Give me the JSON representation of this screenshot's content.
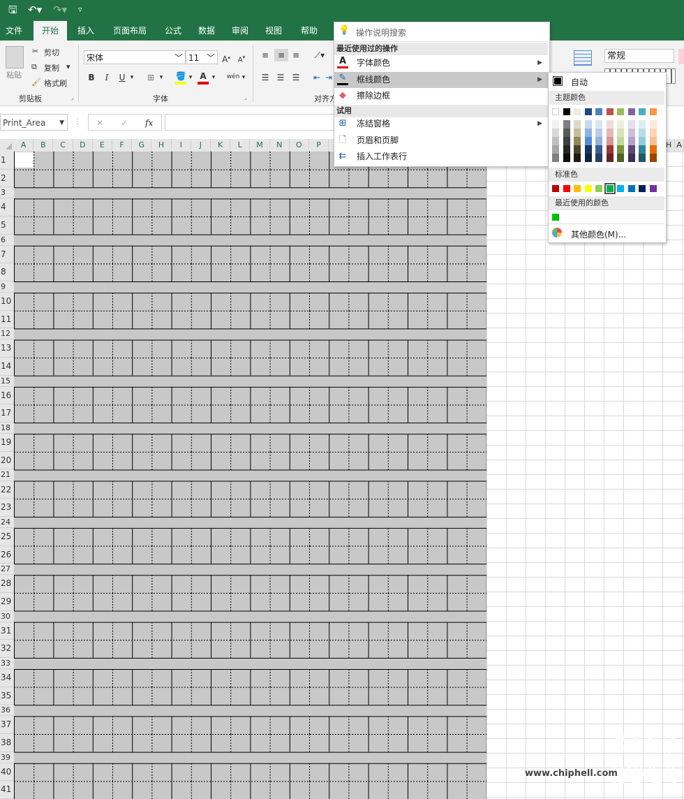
{
  "ribbon_tabs": [
    "文件",
    "开始",
    "插入",
    "页面布局",
    "公式",
    "数据",
    "审阅",
    "视图",
    "帮助"
  ],
  "active_tab": "开始",
  "clipboard": {
    "paste": "粘贴",
    "cut": "剪切",
    "copy": "复制",
    "format_painter": "格式刷",
    "group": "剪贴板"
  },
  "font": {
    "name": "宋体",
    "size": "11",
    "bold": "B",
    "italic": "I",
    "underline": "U",
    "group": "字体",
    "phonetic": "wén"
  },
  "alignment": {
    "group_partial": "对齐方"
  },
  "number_format": {
    "value": "常规"
  },
  "formula_bar": {
    "name_box": "Print_Area",
    "fx": "fx",
    "cancel": "✕",
    "enter": "✓"
  },
  "columns": [
    "A",
    "B",
    "C",
    "D",
    "E",
    "F",
    "G",
    "H",
    "I",
    "J",
    "K",
    "L",
    "M",
    "N",
    "O",
    "P"
  ],
  "columns_right": [
    "H",
    "A"
  ],
  "rows": [
    "1",
    "2",
    "3",
    "4",
    "5",
    "6",
    "7",
    "8",
    "9",
    "10",
    "11",
    "12",
    "13",
    "14",
    "15",
    "16",
    "17",
    "18",
    "19",
    "20",
    "21",
    "22",
    "23",
    "24",
    "25",
    "26",
    "27",
    "28",
    "29",
    "30",
    "31",
    "32",
    "33",
    "34",
    "35",
    "36",
    "37",
    "38",
    "39",
    "40",
    "41"
  ],
  "search_menu": {
    "placeholder": "操作说明搜索",
    "recent_header": "最近使用过的操作",
    "recent_items": [
      {
        "label": "字体颜色",
        "icon": "font-color-icon",
        "has_submenu": true
      },
      {
        "label": "框线颜色",
        "icon": "border-color-icon",
        "has_submenu": true
      },
      {
        "label": "擦除边框",
        "icon": "eraser-icon",
        "has_submenu": false
      }
    ],
    "try_header": "试用",
    "try_items": [
      {
        "label": "冻结窗格",
        "icon": "freeze-panes-icon",
        "has_submenu": true
      },
      {
        "label": "页眉和页脚",
        "icon": "header-footer-icon",
        "has_submenu": false
      },
      {
        "label": "插入工作表行",
        "icon": "insert-rows-icon",
        "has_submenu": false
      }
    ]
  },
  "color_menu": {
    "auto_label": "自动",
    "theme_header": "主题颜色",
    "theme_top": [
      "#ffffff",
      "#000000",
      "#eeece1",
      "#1f497d",
      "#4f81bd",
      "#c0504d",
      "#9bbb59",
      "#8064a2",
      "#4bacc6",
      "#f79646"
    ],
    "theme_shades": [
      [
        "#f2f2f2",
        "#d9d9d9",
        "#bfbfbf",
        "#a6a6a6",
        "#808080"
      ],
      [
        "#7f7f7f",
        "#595959",
        "#3f3f3f",
        "#262626",
        "#0d0d0d"
      ],
      [
        "#ddd9c3",
        "#c4bd97",
        "#948a54",
        "#4a452a",
        "#1e1c11"
      ],
      [
        "#c6d9f0",
        "#8db3e2",
        "#548dd4",
        "#17365d",
        "#0f243e"
      ],
      [
        "#dbe5f1",
        "#b8cce4",
        "#95b3d7",
        "#366092",
        "#244061"
      ],
      [
        "#f2dcdb",
        "#e5b9b7",
        "#d99694",
        "#953734",
        "#632423"
      ],
      [
        "#ebf1dd",
        "#d7e3bc",
        "#c3d69b",
        "#76923c",
        "#4f6128"
      ],
      [
        "#e5e0ec",
        "#ccc1d9",
        "#b2a2c7",
        "#5f497a",
        "#3f3151"
      ],
      [
        "#dbeef3",
        "#b7dde8",
        "#92cddc",
        "#31859b",
        "#205867"
      ],
      [
        "#fdeada",
        "#fbd5b5",
        "#fac08f",
        "#e36c09",
        "#974806"
      ]
    ],
    "standard_header": "标准色",
    "standard": [
      "#c00000",
      "#ff0000",
      "#ffc000",
      "#ffff00",
      "#92d050",
      "#00b050",
      "#00b0f0",
      "#0070c0",
      "#002060",
      "#7030a0"
    ],
    "selected_standard_index": 5,
    "recent_header": "最近使用的颜色",
    "recent": [
      "#00c000"
    ],
    "more_label": "其他颜色(M)..."
  },
  "watermark": {
    "site": "www.chiphell.com"
  }
}
